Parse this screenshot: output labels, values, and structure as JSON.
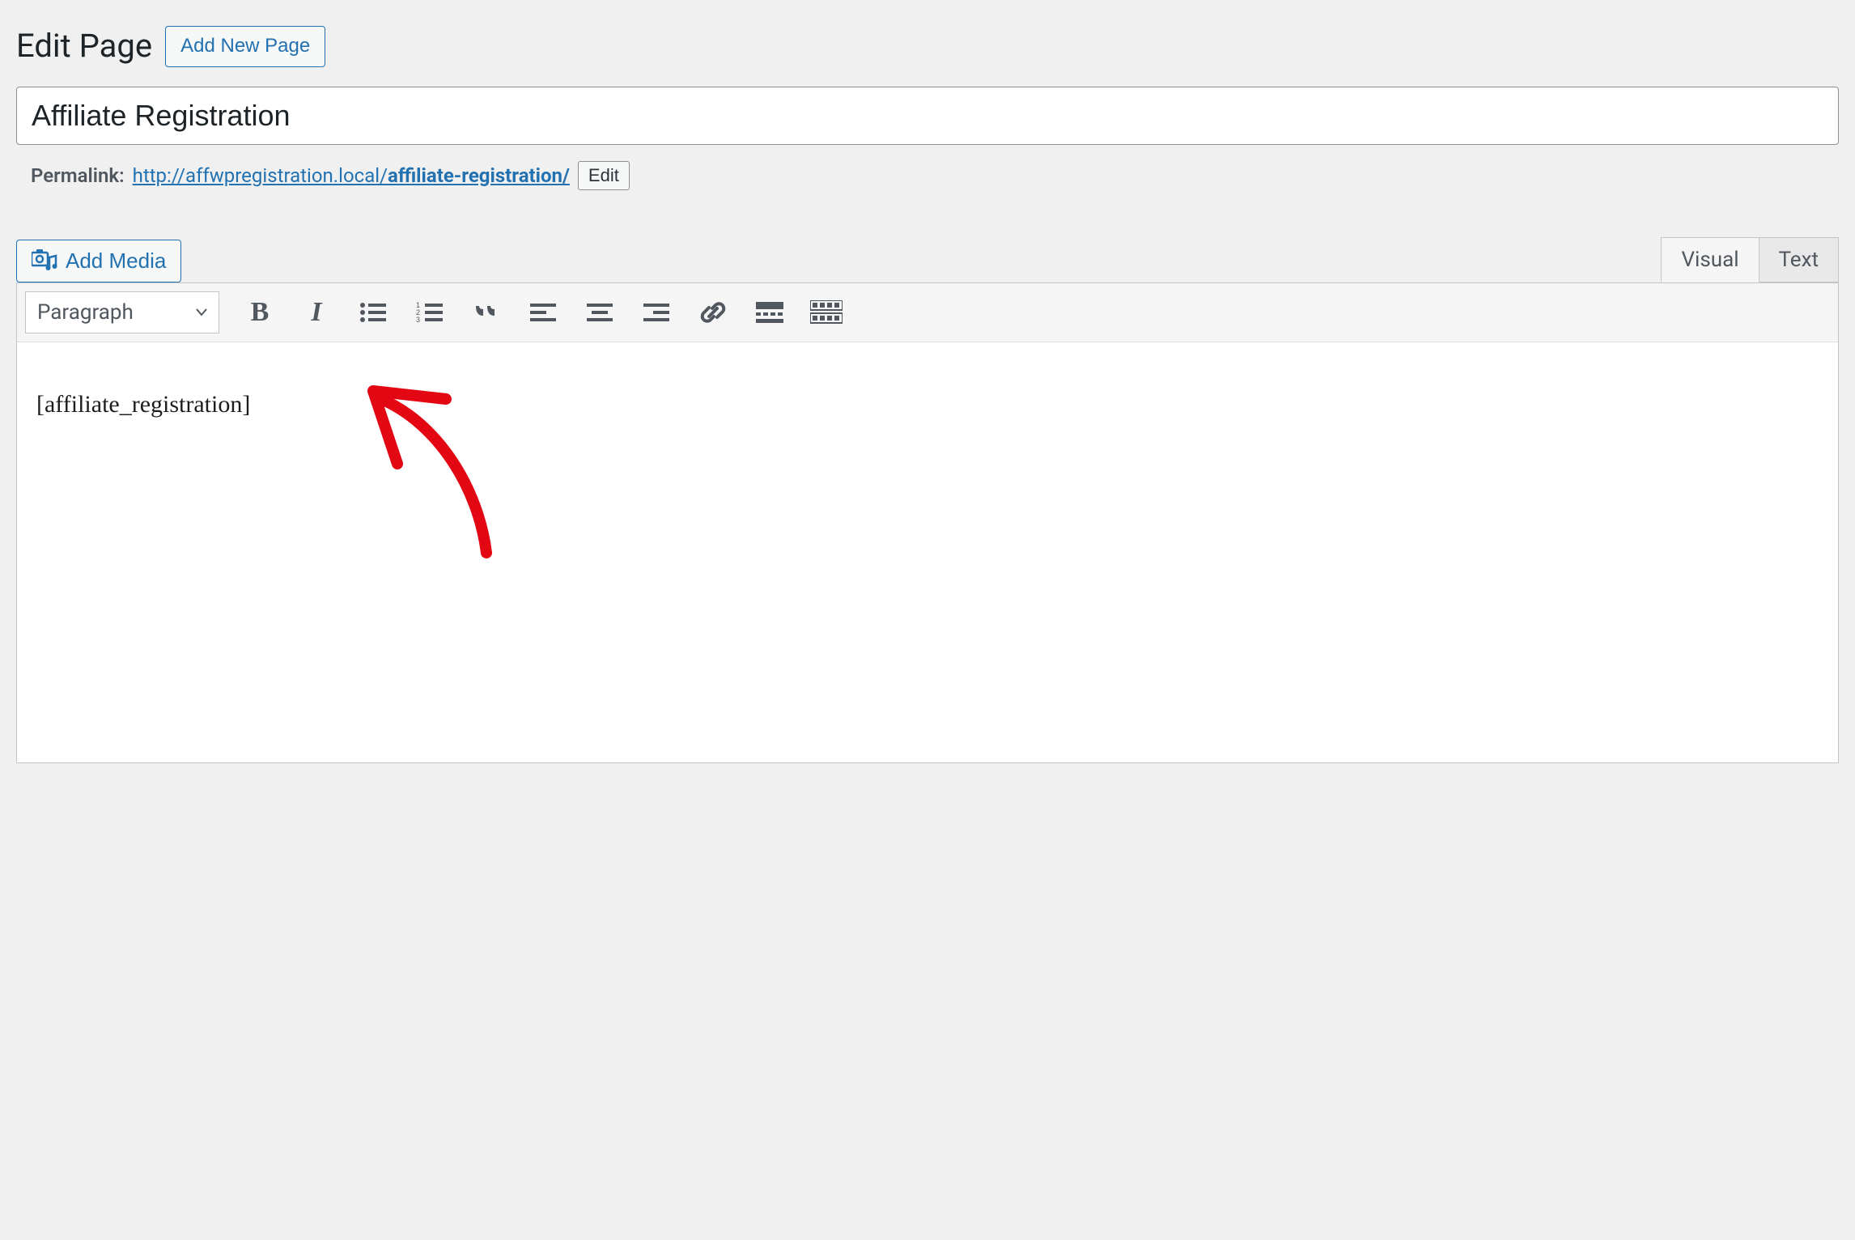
{
  "header": {
    "heading": "Edit Page",
    "add_new_label": "Add New Page"
  },
  "title_input": {
    "value": "Affiliate Registration"
  },
  "permalink": {
    "label": "Permalink:",
    "base_url": "http://affwpregistration.local/",
    "slug": "affiliate-registration/",
    "edit_label": "Edit"
  },
  "media": {
    "add_media_label": "Add Media"
  },
  "tabs": {
    "visual": "Visual",
    "text": "Text"
  },
  "toolbar": {
    "format_selector": "Paragraph"
  },
  "content": {
    "body_text": "[affiliate_registration]"
  },
  "colors": {
    "accent": "#2271b1",
    "annotation": "#e30613"
  }
}
